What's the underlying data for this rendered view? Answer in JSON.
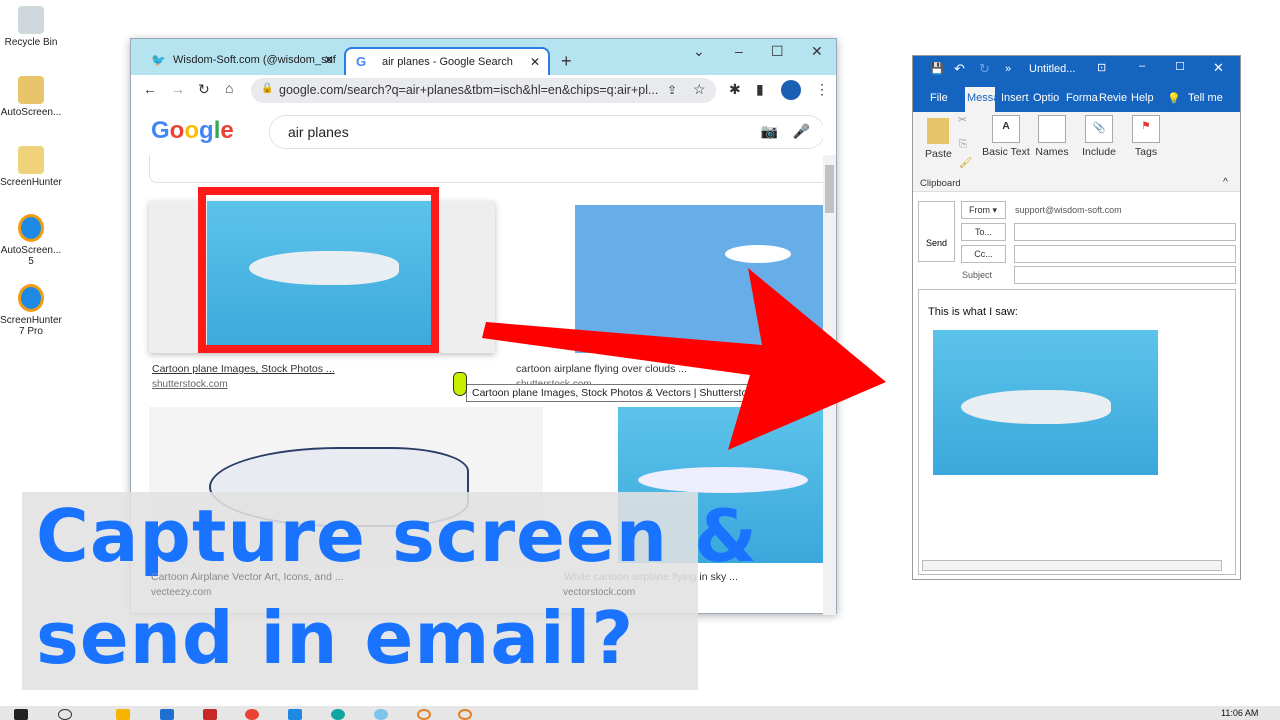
{
  "desktop": {
    "icons": [
      {
        "label": "Recycle Bin"
      },
      {
        "label": "AutoScreen..."
      },
      {
        "label": "ScreenHunter"
      },
      {
        "label": "AutoScreen... 5"
      },
      {
        "label": "ScreenHunter 7 Pro"
      }
    ]
  },
  "browser": {
    "tabs": [
      {
        "label": "Wisdom-Soft.com (@wisdom_sof",
        "icon": "twitter-icon"
      },
      {
        "label": "air planes - Google Search",
        "icon": "google-icon",
        "active": true
      }
    ],
    "url": "google.com/search?q=air+planes&tbm=isch&hl=en&chips=q:air+pl...",
    "logo": "Google",
    "search_query": "air planes",
    "results": [
      {
        "title": "Cartoon plane Images, Stock Photos ...",
        "source": "shutterstock.com"
      },
      {
        "title": "cartoon airplane flying over clouds ...",
        "source": "shutterstock.com"
      },
      {
        "title": "Cartoon Airplane Vector Art, Icons, and ...",
        "source": "vecteezy.com"
      },
      {
        "title": "White cartoon airplane flying in sky ...",
        "source": "vectorstock.com"
      }
    ],
    "tooltip": "Cartoon plane Images, Stock Photos & Vectors | Shutterstock"
  },
  "outlook": {
    "title": "Untitled...",
    "menu": [
      "File",
      "Messa",
      "Insert",
      "Optio",
      "Forma",
      "Revie",
      "Help",
      "Tell me"
    ],
    "ribbon": {
      "paste": "Paste",
      "basic_text": "Basic Text",
      "names": "Names",
      "include": "Include",
      "tags": "Tags",
      "group": "Clipboard"
    },
    "send": "Send",
    "from_label": "From",
    "from_value": "support@wisdom-soft.com",
    "to_label": "To...",
    "cc_label": "Cc...",
    "subject_label": "Subject",
    "body_text": "This is what I saw:"
  },
  "overlay": {
    "line1": "Capture screen &",
    "line2": "send in email?"
  },
  "taskbar": {
    "clock": "11:06 AM"
  },
  "colors": {
    "accent": "#1a73ff",
    "arrow": "#ff0000",
    "outlook_blue": "#1565c0",
    "highlight": "#ff1a1a"
  }
}
